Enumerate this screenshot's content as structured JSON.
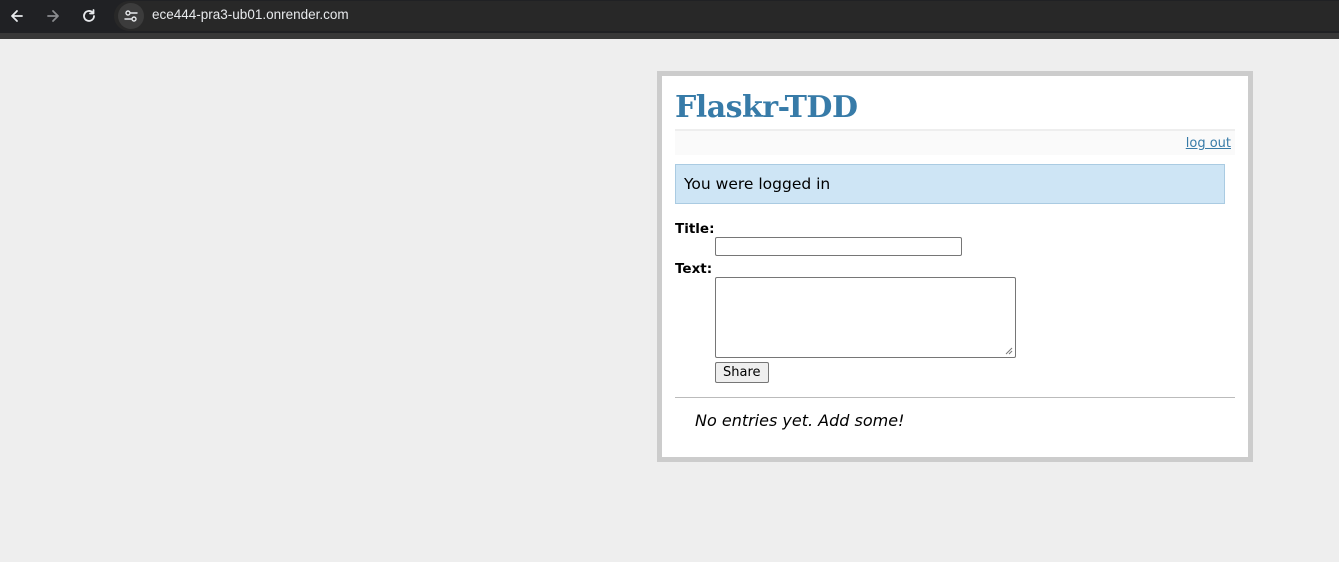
{
  "browser": {
    "url": "ece444-pra3-ub01.onrender.com",
    "back_icon": "back-arrow-icon",
    "forward_icon": "forward-arrow-icon",
    "reload_icon": "reload-icon",
    "site_info_icon": "site-settings-icon"
  },
  "page": {
    "title": "Flaskr-TDD",
    "logout_label": "log out",
    "flash_message": "You were logged in",
    "form": {
      "title_label": "Title:",
      "title_value": "",
      "text_label": "Text:",
      "text_value": "",
      "submit_label": "Share"
    },
    "entries_empty": "No entries yet. Add some!"
  },
  "colors": {
    "accent": "#377ba8",
    "flash_bg": "#cee5f5",
    "page_bg": "#eeeeee",
    "frame_border": "#cccccc"
  }
}
